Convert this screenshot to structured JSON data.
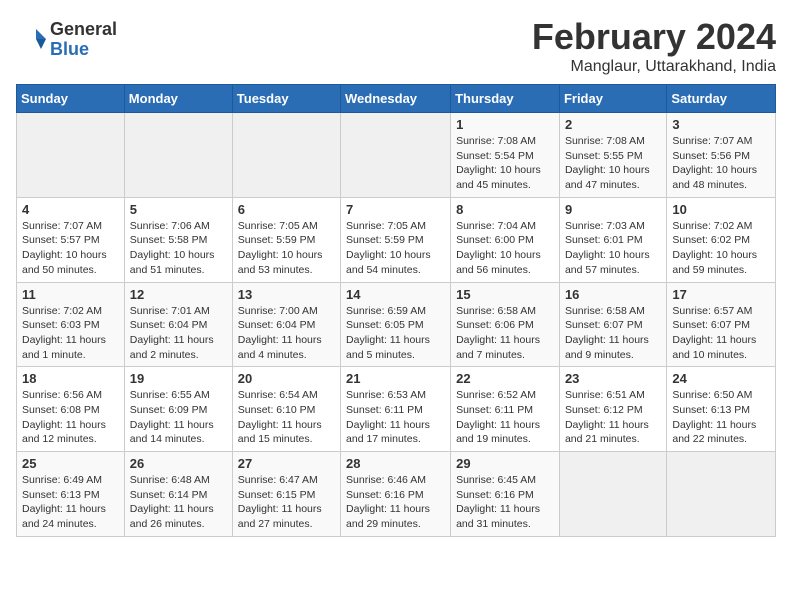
{
  "logo": {
    "general": "General",
    "blue": "Blue"
  },
  "title": {
    "month_year": "February 2024",
    "location": "Manglaur, Uttarakhand, India"
  },
  "weekdays": [
    "Sunday",
    "Monday",
    "Tuesday",
    "Wednesday",
    "Thursday",
    "Friday",
    "Saturday"
  ],
  "weeks": [
    [
      {
        "day": "",
        "info": ""
      },
      {
        "day": "",
        "info": ""
      },
      {
        "day": "",
        "info": ""
      },
      {
        "day": "",
        "info": ""
      },
      {
        "day": "1",
        "info": "Sunrise: 7:08 AM\nSunset: 5:54 PM\nDaylight: 10 hours\nand 45 minutes."
      },
      {
        "day": "2",
        "info": "Sunrise: 7:08 AM\nSunset: 5:55 PM\nDaylight: 10 hours\nand 47 minutes."
      },
      {
        "day": "3",
        "info": "Sunrise: 7:07 AM\nSunset: 5:56 PM\nDaylight: 10 hours\nand 48 minutes."
      }
    ],
    [
      {
        "day": "4",
        "info": "Sunrise: 7:07 AM\nSunset: 5:57 PM\nDaylight: 10 hours\nand 50 minutes."
      },
      {
        "day": "5",
        "info": "Sunrise: 7:06 AM\nSunset: 5:58 PM\nDaylight: 10 hours\nand 51 minutes."
      },
      {
        "day": "6",
        "info": "Sunrise: 7:05 AM\nSunset: 5:59 PM\nDaylight: 10 hours\nand 53 minutes."
      },
      {
        "day": "7",
        "info": "Sunrise: 7:05 AM\nSunset: 5:59 PM\nDaylight: 10 hours\nand 54 minutes."
      },
      {
        "day": "8",
        "info": "Sunrise: 7:04 AM\nSunset: 6:00 PM\nDaylight: 10 hours\nand 56 minutes."
      },
      {
        "day": "9",
        "info": "Sunrise: 7:03 AM\nSunset: 6:01 PM\nDaylight: 10 hours\nand 57 minutes."
      },
      {
        "day": "10",
        "info": "Sunrise: 7:02 AM\nSunset: 6:02 PM\nDaylight: 10 hours\nand 59 minutes."
      }
    ],
    [
      {
        "day": "11",
        "info": "Sunrise: 7:02 AM\nSunset: 6:03 PM\nDaylight: 11 hours\nand 1 minute."
      },
      {
        "day": "12",
        "info": "Sunrise: 7:01 AM\nSunset: 6:04 PM\nDaylight: 11 hours\nand 2 minutes."
      },
      {
        "day": "13",
        "info": "Sunrise: 7:00 AM\nSunset: 6:04 PM\nDaylight: 11 hours\nand 4 minutes."
      },
      {
        "day": "14",
        "info": "Sunrise: 6:59 AM\nSunset: 6:05 PM\nDaylight: 11 hours\nand 5 minutes."
      },
      {
        "day": "15",
        "info": "Sunrise: 6:58 AM\nSunset: 6:06 PM\nDaylight: 11 hours\nand 7 minutes."
      },
      {
        "day": "16",
        "info": "Sunrise: 6:58 AM\nSunset: 6:07 PM\nDaylight: 11 hours\nand 9 minutes."
      },
      {
        "day": "17",
        "info": "Sunrise: 6:57 AM\nSunset: 6:07 PM\nDaylight: 11 hours\nand 10 minutes."
      }
    ],
    [
      {
        "day": "18",
        "info": "Sunrise: 6:56 AM\nSunset: 6:08 PM\nDaylight: 11 hours\nand 12 minutes."
      },
      {
        "day": "19",
        "info": "Sunrise: 6:55 AM\nSunset: 6:09 PM\nDaylight: 11 hours\nand 14 minutes."
      },
      {
        "day": "20",
        "info": "Sunrise: 6:54 AM\nSunset: 6:10 PM\nDaylight: 11 hours\nand 15 minutes."
      },
      {
        "day": "21",
        "info": "Sunrise: 6:53 AM\nSunset: 6:11 PM\nDaylight: 11 hours\nand 17 minutes."
      },
      {
        "day": "22",
        "info": "Sunrise: 6:52 AM\nSunset: 6:11 PM\nDaylight: 11 hours\nand 19 minutes."
      },
      {
        "day": "23",
        "info": "Sunrise: 6:51 AM\nSunset: 6:12 PM\nDaylight: 11 hours\nand 21 minutes."
      },
      {
        "day": "24",
        "info": "Sunrise: 6:50 AM\nSunset: 6:13 PM\nDaylight: 11 hours\nand 22 minutes."
      }
    ],
    [
      {
        "day": "25",
        "info": "Sunrise: 6:49 AM\nSunset: 6:13 PM\nDaylight: 11 hours\nand 24 minutes."
      },
      {
        "day": "26",
        "info": "Sunrise: 6:48 AM\nSunset: 6:14 PM\nDaylight: 11 hours\nand 26 minutes."
      },
      {
        "day": "27",
        "info": "Sunrise: 6:47 AM\nSunset: 6:15 PM\nDaylight: 11 hours\nand 27 minutes."
      },
      {
        "day": "28",
        "info": "Sunrise: 6:46 AM\nSunset: 6:16 PM\nDaylight: 11 hours\nand 29 minutes."
      },
      {
        "day": "29",
        "info": "Sunrise: 6:45 AM\nSunset: 6:16 PM\nDaylight: 11 hours\nand 31 minutes."
      },
      {
        "day": "",
        "info": ""
      },
      {
        "day": "",
        "info": ""
      }
    ]
  ]
}
